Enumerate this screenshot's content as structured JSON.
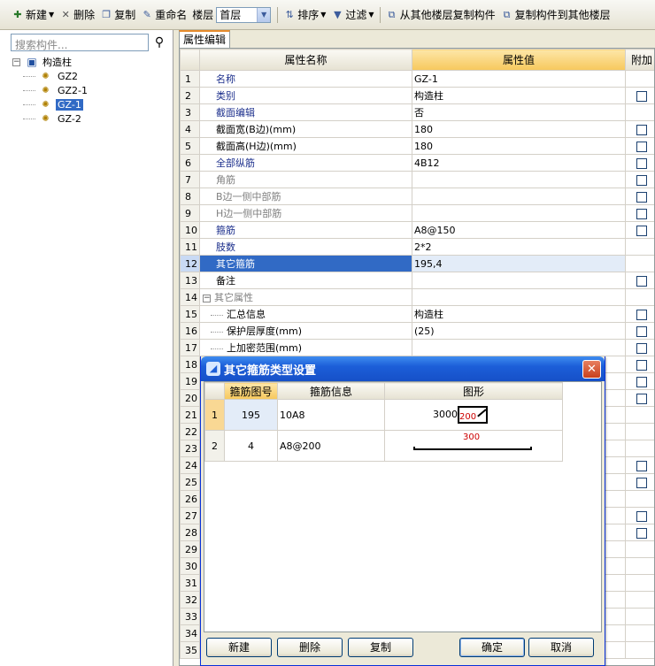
{
  "toolbar": {
    "new_label": "新建",
    "delete_label": "删除",
    "copy_label": "复制",
    "rename_label": "重命名",
    "floor_label": "楼层",
    "floor_value": "首层",
    "sort_label": "排序",
    "filter_label": "过滤",
    "copy_from_label": "从其他楼层复制构件",
    "copy_to_label": "复制构件到其他楼层"
  },
  "left": {
    "search_placeholder": "搜索构件...",
    "tree_root": "构造柱",
    "tree_items": [
      "GZ2",
      "GZ2-1",
      "GZ-1",
      "GZ-2"
    ],
    "selected_item": "GZ-1"
  },
  "tab_label": "属性编辑",
  "grid": {
    "headers": {
      "name": "属性名称",
      "value": "属性值",
      "add": "附加"
    },
    "rows": [
      {
        "n": "1",
        "name": "名称",
        "value": "GZ-1"
      },
      {
        "n": "2",
        "name": "类别",
        "value": "构造柱"
      },
      {
        "n": "3",
        "name": "截面编辑",
        "value": "否"
      },
      {
        "n": "4",
        "name": "截面宽(B边)(mm)",
        "value": "180"
      },
      {
        "n": "5",
        "name": "截面高(H边)(mm)",
        "value": "180"
      },
      {
        "n": "6",
        "name": "全部纵筋",
        "value": "4B12"
      },
      {
        "n": "7",
        "name": "角筋",
        "value": ""
      },
      {
        "n": "8",
        "name": "B边一侧中部筋",
        "value": ""
      },
      {
        "n": "9",
        "name": "H边一侧中部筋",
        "value": ""
      },
      {
        "n": "10",
        "name": "箍筋",
        "value": "A8@150"
      },
      {
        "n": "11",
        "name": "肢数",
        "value": "2*2"
      },
      {
        "n": "12",
        "name": "其它箍筋",
        "value": "195,4"
      },
      {
        "n": "13",
        "name": "备注",
        "value": ""
      },
      {
        "n": "14",
        "name": "其它属性",
        "value": ""
      },
      {
        "n": "15",
        "name": "汇总信息",
        "value": "构造柱"
      },
      {
        "n": "16",
        "name": "保护层厚度(mm)",
        "value": "(25)"
      },
      {
        "n": "17",
        "name": "上加密范围(mm)",
        "value": ""
      }
    ],
    "more_row_numbers": [
      "18",
      "19",
      "20",
      "21",
      "22",
      "23",
      "24",
      "25",
      "26",
      "27",
      "28",
      "29",
      "30",
      "31",
      "32",
      "33",
      "34",
      "35"
    ]
  },
  "dialog": {
    "title": "其它箍筋类型设置",
    "headers": {
      "code": "箍筋图号",
      "info": "箍筋信息",
      "shape": "图形"
    },
    "rows": [
      {
        "n": "1",
        "code": "195",
        "info": "10A8",
        "dim1": "3000",
        "dim2": "200"
      },
      {
        "n": "2",
        "code": "4",
        "info": "A8@200",
        "dim1": "300"
      }
    ],
    "buttons": {
      "new": "新建",
      "delete": "删除",
      "copy": "复制",
      "ok": "确定",
      "cancel": "取消"
    }
  }
}
